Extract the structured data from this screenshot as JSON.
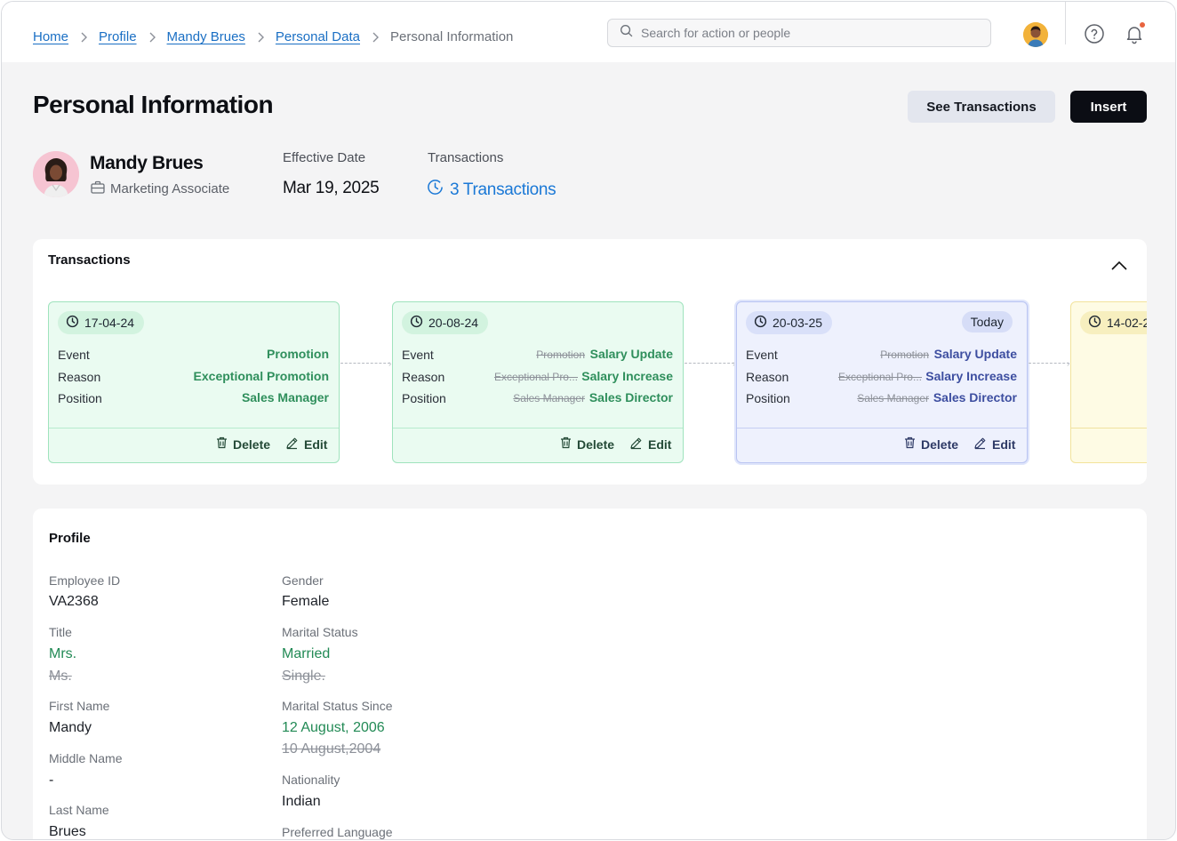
{
  "breadcrumb": {
    "items": [
      "Home",
      "Profile",
      "Mandy Brues",
      "Personal Data"
    ],
    "current": "Personal Information"
  },
  "search": {
    "placeholder": "Search for action or people"
  },
  "header": {
    "title": "Personal Information",
    "see_transactions_label": "See  Transactions",
    "insert_label": "Insert"
  },
  "person": {
    "name": "Mandy Brues",
    "role": "Marketing Associate",
    "effective_date_label": "Effective Date",
    "effective_date": "Mar 19, 2025",
    "transactions_label": "Transactions",
    "transactions_link": "3 Transactions"
  },
  "transactions": {
    "title": "Transactions",
    "row_labels": {
      "event": "Event",
      "reason": "Reason",
      "position": "Position"
    },
    "delete_label": "Delete",
    "edit_label": "Edit",
    "today_label": "Today",
    "cards": [
      {
        "date": "17-04-24",
        "event": "Promotion",
        "reason": "Exceptional Promotion",
        "position": "Sales Manager"
      },
      {
        "date": "20-08-24",
        "event": "Salary Update",
        "event_old": "Promotion",
        "reason": "Salary Increase",
        "reason_old": "Exceptional Pro...",
        "position": "Sales Director",
        "position_old": "Sales Manager"
      },
      {
        "date": "20-03-25",
        "event": "Salary Update",
        "event_old": "Promotion",
        "reason": "Salary Increase",
        "reason_old": "Exceptional Pro...",
        "position": "Sales Director",
        "position_old": "Sales Manager"
      },
      {
        "date": "14-02-2"
      }
    ]
  },
  "profile": {
    "title": "Profile",
    "employee_id_label": "Employee ID",
    "employee_id": "VA2368",
    "title_label": "Title",
    "title_value": "Mrs.",
    "title_old": "Ms.",
    "first_name_label": "First Name",
    "first_name": "Mandy",
    "middle_name_label": "Middle Name",
    "middle_name": "-",
    "last_name_label": "Last Name",
    "last_name": "Brues",
    "gender_label": "Gender",
    "gender": "Female",
    "marital_status_label": "Marital Status",
    "marital_status": "Married",
    "marital_status_old": "Single.",
    "marital_since_label": "Marital Status Since",
    "marital_since": "12 August, 2006",
    "marital_since_old": "10 August,2004",
    "nationality_label": "Nationality",
    "nationality": "Indian",
    "preferred_language_label": "Preferred Language"
  },
  "colors": {
    "link": "#1a6fc4",
    "accent_green": "#2f8f5c",
    "accent_blue": "#3d4ea0",
    "primary_button": "#0b0d14"
  }
}
